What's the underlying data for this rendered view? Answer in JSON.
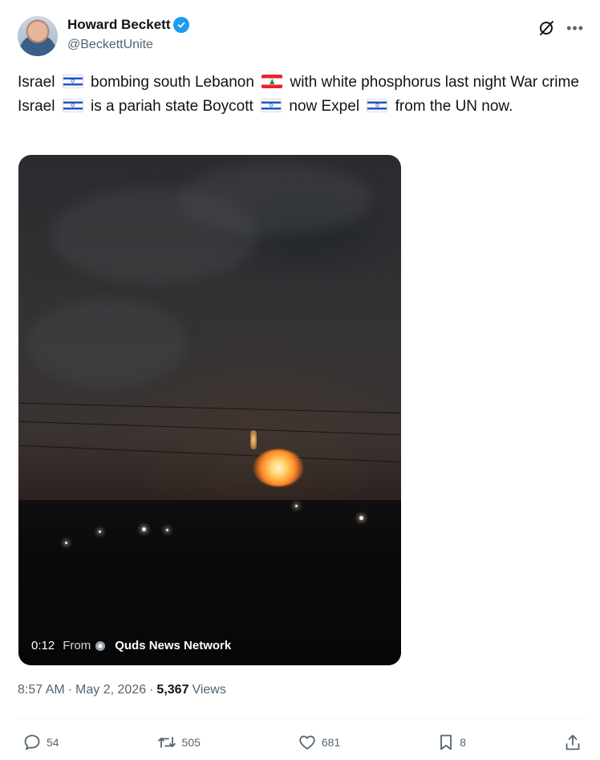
{
  "author": {
    "name": "Howard Beckett",
    "handle": "@BeckettUnite",
    "verified": true
  },
  "tweet": {
    "segments": [
      {
        "type": "text",
        "value": "Israel "
      },
      {
        "type": "flag",
        "value": "israel-flag-icon"
      },
      {
        "type": "text",
        "value": " bombing south Lebanon "
      },
      {
        "type": "flag",
        "value": "lebanon-flag-icon"
      },
      {
        "type": "text",
        "value": " with white phosphorus last night War crime Israel "
      },
      {
        "type": "flag",
        "value": "israel-flag-icon"
      },
      {
        "type": "text",
        "value": " is a pariah state Boycott "
      },
      {
        "type": "flag",
        "value": "israel-flag-icon"
      },
      {
        "type": "text",
        "value": " now Expel "
      },
      {
        "type": "flag",
        "value": "israel-flag-icon"
      },
      {
        "type": "text",
        "value": " from the UN now."
      }
    ]
  },
  "video": {
    "duration": "0:12",
    "from_label": "From",
    "source": "Quds News Network"
  },
  "meta": {
    "time": "8:57 AM",
    "separator": "·",
    "date": "May 2, 2026",
    "views_count": "5,367",
    "views_label": "Views"
  },
  "actions": {
    "replies": "54",
    "reposts": "505",
    "likes": "681",
    "bookmarks": "8"
  },
  "colors": {
    "accent": "#1d9bf0",
    "secondary_text": "#536471",
    "primary_text": "#0f1419"
  }
}
